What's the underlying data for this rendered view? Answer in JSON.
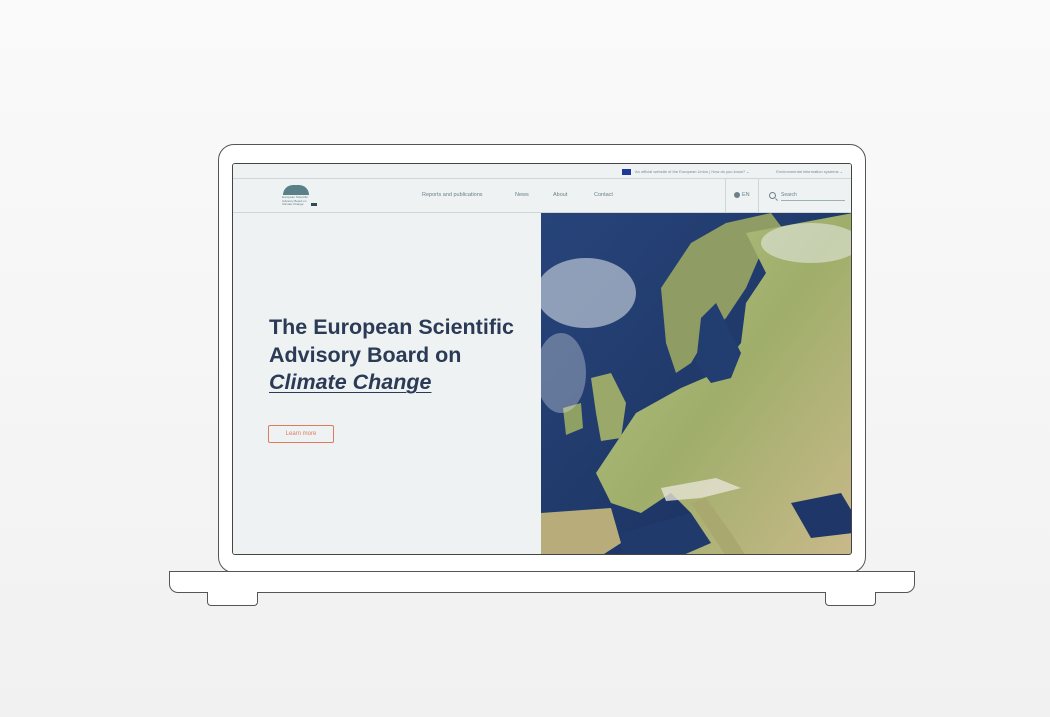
{
  "topbar": {
    "official_text": "An official website of the European Union | How do you know? ⌄",
    "env_text": "Environmental information systems ⌄"
  },
  "logo": {
    "text": "European Scientific\nAdvisory Board on\nClimate Change"
  },
  "nav": {
    "items": [
      "Reports and publications",
      "News",
      "About",
      "Contact"
    ],
    "language": "EN",
    "search_placeholder": "Search"
  },
  "hero": {
    "title_line1": "The European Scientific",
    "title_line2": "Advisory Board on",
    "title_line3": "Climate Change",
    "button_label": "Learn more"
  },
  "colors": {
    "accent": "#e07a5f",
    "title": "#2b3a55",
    "background": "#eef2f3",
    "eu_blue": "#1d3b96"
  },
  "icons": [
    "eu-flag-icon",
    "globe-icon",
    "search-icon",
    "logo-icon"
  ]
}
